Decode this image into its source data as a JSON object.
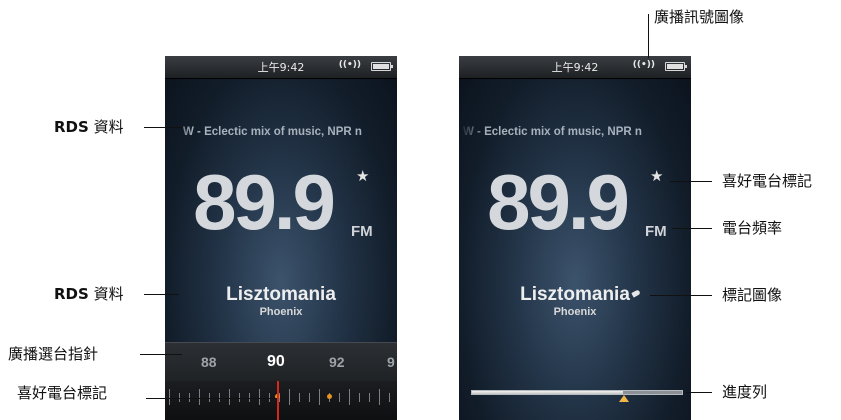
{
  "screens": {
    "left": {
      "status_time": "上午9:42",
      "status_radio": "((•))",
      "rds_text": "W - Eclectic mix of music, NPR n",
      "frequency": "89.9",
      "band": "FM",
      "favorite_star": "★",
      "song_title": "Lisztomania",
      "song_artist": "Phoenix",
      "tuner_numbers": [
        "88",
        "90",
        "92",
        "9"
      ],
      "tuner_active": "90"
    },
    "right": {
      "status_time": "上午9:42",
      "status_radio": "((•))",
      "rds_text": "W - Eclectic mix of music, NPR n",
      "frequency": "89.9",
      "band": "FM",
      "favorite_star": "★",
      "song_title": "Lisztomania",
      "song_artist": "Phoenix",
      "progress_fraction": 0.72
    }
  },
  "callouts": {
    "rds_top": {
      "prefix": "RDS",
      "text": " 資料"
    },
    "rds_bottom": {
      "prefix": "RDS",
      "text": " 資料"
    },
    "tuning_needle": "廣播選台指針",
    "favorite_marker_left": "喜好電台標記",
    "signal_icon": "廣播訊號圖像",
    "favorite_marker_right": "喜好電台標記",
    "station_frequency": "電台頻率",
    "tag_icon": "標記圖像",
    "progress_bar": "進度列"
  },
  "colors": {
    "needle": "#d7281b",
    "favorite_dot": "#e5941f",
    "progress_thumb": "#f1b64a"
  }
}
